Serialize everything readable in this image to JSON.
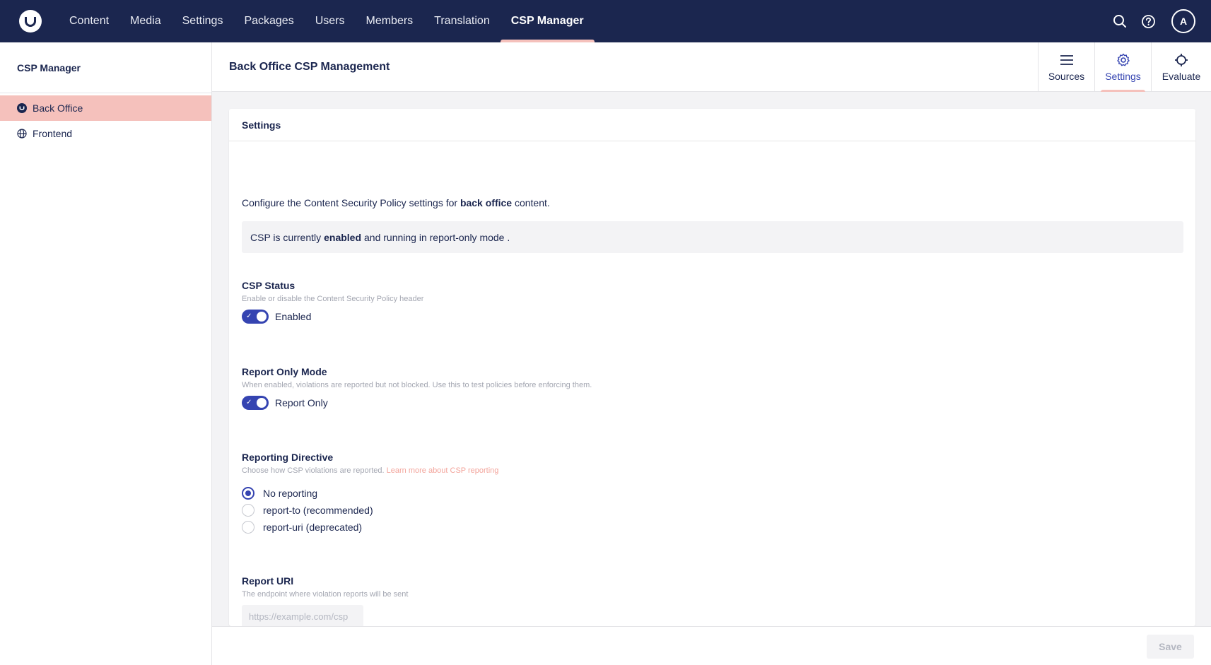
{
  "nav": {
    "items": [
      {
        "label": "Content"
      },
      {
        "label": "Media"
      },
      {
        "label": "Settings"
      },
      {
        "label": "Packages"
      },
      {
        "label": "Users"
      },
      {
        "label": "Members"
      },
      {
        "label": "Translation"
      },
      {
        "label": "CSP Manager",
        "active": true
      }
    ],
    "user_initial": "A",
    "icons": [
      "search-icon",
      "help-icon"
    ]
  },
  "sidebar": {
    "title": "CSP Manager",
    "items": [
      {
        "label": "Back Office",
        "icon": "umbraco-icon",
        "active": true
      },
      {
        "label": "Frontend",
        "icon": "globe-icon"
      }
    ]
  },
  "header": {
    "title": "Back Office CSP Management",
    "tabs": [
      {
        "label": "Sources",
        "icon": "list-icon"
      },
      {
        "label": "Settings",
        "icon": "gear-icon",
        "active": true
      },
      {
        "label": "Evaluate",
        "icon": "crosshair-icon"
      }
    ]
  },
  "settings": {
    "card_title": "Settings",
    "intro_prefix": "Configure the Content Security Policy settings for",
    "intro_bold": "back office",
    "intro_suffix": "content.",
    "status_prefix": "CSP is currently",
    "status_bold": "enabled",
    "status_suffix": "and running in report-only mode .",
    "csp_status": {
      "label": "CSP Status",
      "description": "Enable or disable the Content Security Policy header",
      "toggle_label": "Enabled",
      "on": true
    },
    "report_only": {
      "label": "Report Only Mode",
      "description": "When enabled, violations are reported but not blocked. Use this to test policies before enforcing them.",
      "toggle_label": "Report Only",
      "on": true
    },
    "reporting_directive": {
      "label": "Reporting Directive",
      "description": "Choose how CSP violations are reported.",
      "link_text": "Learn more about CSP reporting",
      "options": [
        {
          "label": "No reporting",
          "checked": true
        },
        {
          "label": "report-to (recommended)",
          "checked": false
        },
        {
          "label": "report-uri (deprecated)",
          "checked": false
        }
      ]
    },
    "report_uri": {
      "label": "Report URI",
      "description": "The endpoint where violation reports will be sent",
      "value": "",
      "placeholder": "https://example.com/csp"
    }
  },
  "footer": {
    "save_label": "Save"
  },
  "colors": {
    "header_bg": "#1b264f",
    "accent": "#3544b1",
    "highlight": "#f5c1bc",
    "link": "#f3a49b"
  }
}
